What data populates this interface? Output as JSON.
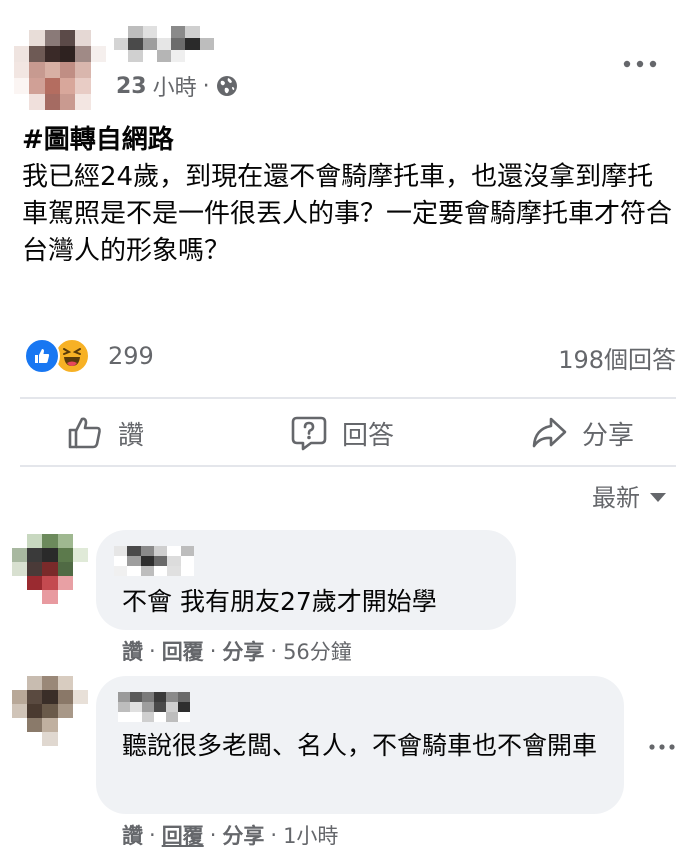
{
  "post": {
    "time_number": "23",
    "time_unit": "小時",
    "separator": "·",
    "hashtag": "#圖轉自網路",
    "body": "我已經24歲，到現在還不會騎摩托車，也還沒拿到摩托車駕照是不是一件很丟人的事？一定要會騎摩托車才符合台灣人的形象嗎？",
    "privacy_icon": "globe-icon",
    "more_icon": "more-horizontal-icon"
  },
  "reactions": {
    "count": "299",
    "icons": [
      "like-icon",
      "haha-icon"
    ],
    "answers_count": "198個回答"
  },
  "actions": {
    "like_label": "讚",
    "answer_label": "回答",
    "share_label": "分享"
  },
  "sort": {
    "label": "最新"
  },
  "comments": [
    {
      "text": "不會 我有朋友27歲才開始學",
      "like": "讚",
      "reply": "回覆",
      "share": "分享",
      "time": "56分鐘"
    },
    {
      "text": "聽說很多老闆、名人，不會騎車也不會開車",
      "like": "讚",
      "reply": "回覆",
      "share": "分享",
      "time": "1小時"
    }
  ],
  "colors": {
    "primary_text": "#050505",
    "secondary_text": "#65676b",
    "bubble": "#f0f2f5",
    "like_blue": "#1877f2",
    "haha_yellow": "#f7b125",
    "divider": "#e4e6eb"
  }
}
